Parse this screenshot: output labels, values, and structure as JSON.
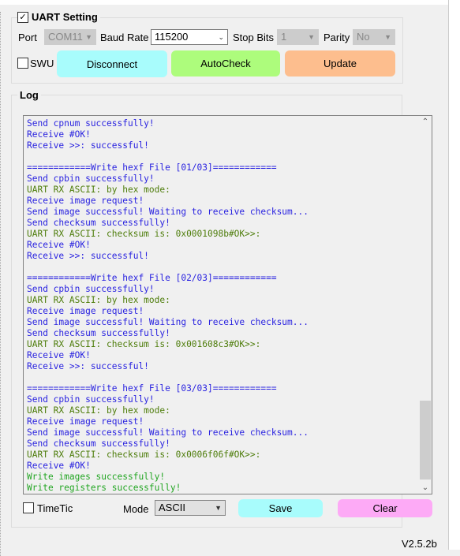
{
  "uart": {
    "title": "UART Setting",
    "enabled": true,
    "port_label": "Port",
    "port_value": "COM11",
    "baud_label": "Baud Rate",
    "baud_value": "115200",
    "stop_label": "Stop Bits",
    "stop_value": "1",
    "parity_label": "Parity",
    "parity_value": "No",
    "swu_label": "SWU",
    "swu_checked": false,
    "buttons": {
      "disconnect": "Disconnect",
      "autocheck": "AutoCheck",
      "update": "Update"
    }
  },
  "colors": {
    "disconnect": "#a8fcfc",
    "autocheck": "#adfc7c",
    "update": "#fdbe8e",
    "save": "#a8fcfc",
    "clear": "#fdaaf6",
    "log_blue": "#2a23e0",
    "log_olive": "#4e7d0b",
    "log_green": "#22a522"
  },
  "log": {
    "title": "Log",
    "lines": [
      {
        "t": "Send cpnum successfully!",
        "c": "blue"
      },
      {
        "t": "Receive #OK!",
        "c": "blue"
      },
      {
        "t": "Receive >>: successful!",
        "c": "blue"
      },
      {
        "t": "",
        "c": "blue"
      },
      {
        "t": "============Write hexf File [01/03]============",
        "c": "blue"
      },
      {
        "t": "Send cpbin successfully!",
        "c": "blue"
      },
      {
        "t": "UART RX ASCII: by hex mode:",
        "c": "olive"
      },
      {
        "t": "Receive image request!",
        "c": "blue"
      },
      {
        "t": "Send image successful! Waiting to receive checksum...",
        "c": "blue"
      },
      {
        "t": "Send checksum successfully!",
        "c": "blue"
      },
      {
        "t": "UART RX ASCII: checksum is: 0x0001098b#OK>>:",
        "c": "olive"
      },
      {
        "t": "Receive #OK!",
        "c": "blue"
      },
      {
        "t": "Receive >>: successful!",
        "c": "blue"
      },
      {
        "t": "",
        "c": "blue"
      },
      {
        "t": "============Write hexf File [02/03]============",
        "c": "blue"
      },
      {
        "t": "Send cpbin successfully!",
        "c": "blue"
      },
      {
        "t": "UART RX ASCII: by hex mode:",
        "c": "olive"
      },
      {
        "t": "Receive image request!",
        "c": "blue"
      },
      {
        "t": "Send image successful! Waiting to receive checksum...",
        "c": "blue"
      },
      {
        "t": "Send checksum successfully!",
        "c": "blue"
      },
      {
        "t": "UART RX ASCII: checksum is: 0x001608c3#OK>>:",
        "c": "olive"
      },
      {
        "t": "Receive #OK!",
        "c": "blue"
      },
      {
        "t": "Receive >>: successful!",
        "c": "blue"
      },
      {
        "t": "",
        "c": "blue"
      },
      {
        "t": "============Write hexf File [03/03]============",
        "c": "blue"
      },
      {
        "t": "Send cpbin successfully!",
        "c": "blue"
      },
      {
        "t": "UART RX ASCII: by hex mode:",
        "c": "olive"
      },
      {
        "t": "Receive image request!",
        "c": "blue"
      },
      {
        "t": "Send image successful! Waiting to receive checksum...",
        "c": "blue"
      },
      {
        "t": "Send checksum successfully!",
        "c": "blue"
      },
      {
        "t": "UART RX ASCII: checksum is: 0x0006f06f#OK>>:",
        "c": "olive"
      },
      {
        "t": "Receive #OK!",
        "c": "blue"
      },
      {
        "t": "Write images successfully!",
        "c": "green"
      },
      {
        "t": "Write registers successfully!",
        "c": "green"
      }
    ],
    "timetic_label": "TimeTic",
    "timetic_checked": false,
    "mode_label": "Mode",
    "mode_value": "ASCII",
    "save": "Save",
    "clear": "Clear"
  },
  "version": "V2.5.2b"
}
